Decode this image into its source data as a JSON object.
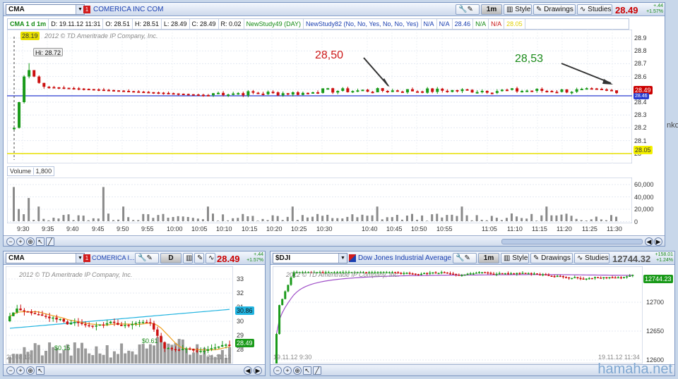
{
  "main": {
    "symbol": "CMA",
    "company": "COMERICA INC COM",
    "aggregation": "1m",
    "style_label": "Style",
    "drawings_label": "Drawings",
    "studies_label": "Studies",
    "price": "28.49",
    "change": "+.44",
    "change_pct": "+1.57%",
    "info": {
      "chart": "CMA 1 d 1m",
      "date": "D: 19.11.12 11:31",
      "open": "O: 28.51",
      "high": "H: 28.51",
      "low": "L: 28.49",
      "close": "C: 28.49",
      "range": "R: 0.02",
      "study1": "NewStudy49 (DAY)",
      "study2": "NewStudy82 (No, No, Yes, No, No, Yes)",
      "na1": "N/A",
      "na2": "N/A",
      "v1": "28.46",
      "na3": "N/A",
      "na4": "N/A",
      "v2": "28.05"
    },
    "copyright": "2012 © TD Ameritrade IP Company, Inc.",
    "current_tag": "28.19",
    "high_label": "Hi: 28.72",
    "annotation_red": "28,50",
    "annotation_green": "28,53",
    "price_tag": "28.49",
    "yellow_tag": "28.05",
    "blue_tag": "28.46",
    "y_labels": [
      "28.9",
      "28.8",
      "28.7",
      "28.6",
      "28.5",
      "28.4",
      "28.3",
      "28.2",
      "28.1",
      "28"
    ],
    "volume_label": "Volume",
    "volume_value": "1,800",
    "volume_y_labels": [
      "60,000",
      "40,000",
      "20,000",
      "0"
    ],
    "x_labels": [
      "9:30",
      "9:35",
      "9:40",
      "9:45",
      "9:50",
      "9:55",
      "10:00",
      "10:05",
      "10:10",
      "10:15",
      "10:20",
      "10:25",
      "10:30",
      "10:40",
      "10:45",
      "10:50",
      "10:55",
      "11:05",
      "11:10",
      "11:15",
      "11:20",
      "11:25",
      "11:30"
    ]
  },
  "bottom_left": {
    "symbol": "CMA",
    "company": "COMERICA I...",
    "aggregation": "D",
    "price": "28.49",
    "change": "+.44",
    "change_pct": "+1.57%",
    "copyright": "2012 © TD Ameritrade IP Company, Inc.",
    "y_labels": [
      "33",
      "32",
      "31",
      "30",
      "29",
      "28"
    ],
    "ma_tag": "30.86",
    "price_tag": "28.49",
    "div1": "$0.15",
    "div2": "$0.61",
    "date_left": "20.08.12",
    "date_right": "21.11.12"
  },
  "bottom_right": {
    "symbol": "$DJI",
    "company": "Dow Jones Industrial Average",
    "aggregation": "1m",
    "style_label": "Style",
    "drawings_label": "Drawings",
    "studies_label": "Studies",
    "price": "12744.32",
    "change": "+158.01",
    "change_pct": "+1.24%",
    "copyright": "2012 © TD Ameritrade IP Company, Inc.",
    "price_tag": "12744.23",
    "y_labels": [
      "12700",
      "12650",
      "12600"
    ],
    "date_left": "19.11.12 9:30",
    "date_right": "19.11.12 11:34"
  },
  "side_text": "nko",
  "watermark": "hamaha.net",
  "colors": {
    "up": "#1a9a1a",
    "down": "#cc1010",
    "ma_orange": "#f0a020",
    "ma_cyan": "#22b4e0",
    "ma_purple": "#a050c8",
    "yellow_line": "#e8e000",
    "blue_line": "#2a3cd0"
  }
}
